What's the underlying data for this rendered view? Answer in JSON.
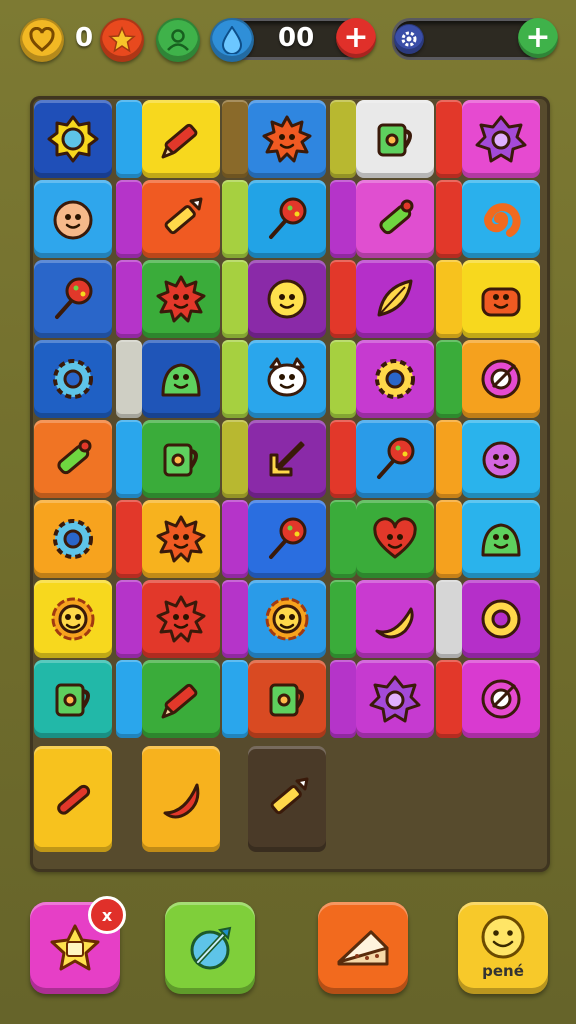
{
  "hud": {
    "hearts_count": "0",
    "gems_count": "00",
    "icons": [
      "heart-icon",
      "star-icon",
      "profile-icon",
      "gem-icon",
      "settings-gear-icon"
    ],
    "colors": {
      "accent_red": "#e0302a",
      "accent_green": "#3fb24a",
      "gold": "#f2b824"
    }
  },
  "board": {
    "rows": [
      [
        "gear-badge-icon",
        "pencil-icon",
        "sun-creature-icon",
        "mug-icon",
        "spiked-blob-icon"
      ],
      [
        "baby-face-icon",
        "crayon-icon",
        "lollipop-icon",
        "paint-tube-icon",
        "spiral-icon"
      ],
      [
        "lollipop-icon",
        "spiky-creature-icon",
        "sun-face-icon",
        "leaf-icon",
        "cake-creature-icon"
      ],
      [
        "gear-icon",
        "slime-icon",
        "cat-face-icon",
        "gear-ring-icon",
        "target-icon"
      ],
      [
        "paint-tube-icon",
        "mug-icon",
        "arrow-icon",
        "lollipop-icon",
        "blob-face-icon"
      ],
      [
        "gear-icon",
        "sun-creature-icon",
        "lollipop-icon",
        "heart-icon",
        "slime-icon"
      ],
      [
        "flower-face-icon",
        "spiky-creature-icon",
        "flower-face-icon",
        "banana-icon",
        "donut-icon"
      ],
      [
        "mug-icon",
        "pencil-icon",
        "mug-icon",
        "spiked-blob-icon",
        "target-icon"
      ],
      [
        "sausage-icon",
        "chili-icon",
        "crayon-icon"
      ]
    ]
  },
  "buttons": {
    "shuffle_badge": "x",
    "done_label": "pené",
    "icons": [
      "star-card-icon",
      "pencil-swap-icon",
      "cake-slice-icon",
      "smiley-icon"
    ]
  }
}
